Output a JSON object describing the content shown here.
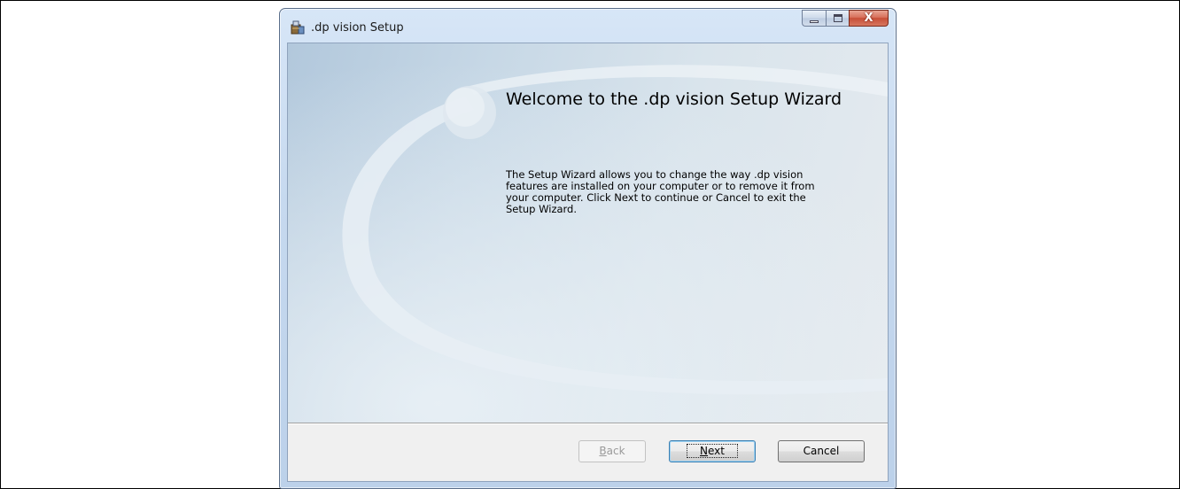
{
  "window": {
    "title": ".dp vision Setup",
    "icon": "installer-package-icon",
    "caption": {
      "minimize_icon": "minimize-icon",
      "maximize_icon": "maximize-icon",
      "close_icon": "close-icon",
      "close_glyph": "X"
    }
  },
  "welcome": {
    "title": "Welcome to the .dp vision Setup Wizard",
    "body_lines": [
      "The Setup Wizard allows you to change the way .dp vision",
      "features are installed on your computer or to remove it from",
      "your computer. Click Next to continue or Cancel to exit the",
      "Setup Wizard."
    ]
  },
  "buttons": {
    "back": {
      "mnemonic": "B",
      "rest": "ack",
      "enabled": false
    },
    "next": {
      "mnemonic": "N",
      "rest": "ext",
      "enabled": true,
      "focused": true
    },
    "cancel": {
      "label": "Cancel",
      "enabled": true
    }
  },
  "colors": {
    "banner_blue": "#b2c8dc",
    "close_red": "#c74e37",
    "focus_blue": "#3c7fb1"
  }
}
